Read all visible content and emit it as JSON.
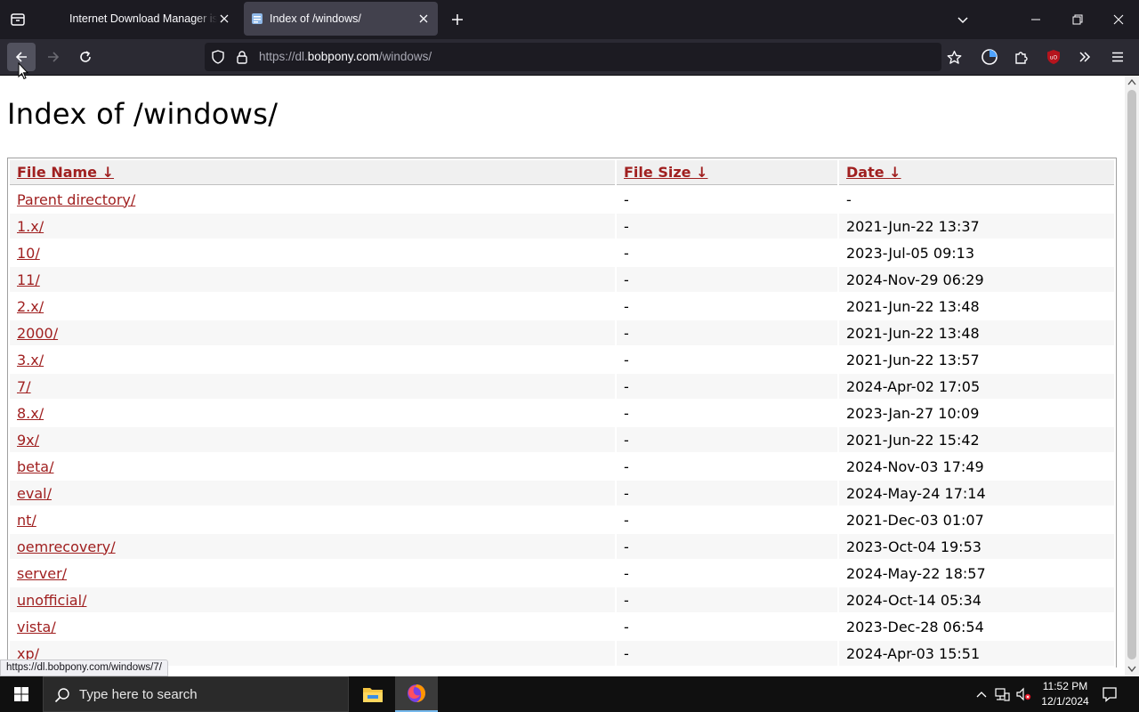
{
  "browser": {
    "tabs": [
      {
        "title": "Internet Download Manager is c"
      },
      {
        "title": "Index of /windows/"
      }
    ],
    "url": {
      "host_prefix": "https://dl.",
      "host_main": "bobpony.com",
      "path": "/windows/"
    }
  },
  "page": {
    "title": "Index of /windows/",
    "columns": {
      "name": "File Name  ↓",
      "size": "File Size  ↓",
      "date": "Date  ↓"
    },
    "rows": [
      {
        "name": "Parent directory/",
        "size": "-",
        "date": "-"
      },
      {
        "name": "1.x/",
        "size": "-",
        "date": "2021-Jun-22 13:37"
      },
      {
        "name": "10/",
        "size": "-",
        "date": "2023-Jul-05 09:13"
      },
      {
        "name": "11/",
        "size": "-",
        "date": "2024-Nov-29 06:29"
      },
      {
        "name": "2.x/",
        "size": "-",
        "date": "2021-Jun-22 13:48"
      },
      {
        "name": "2000/",
        "size": "-",
        "date": "2021-Jun-22 13:48"
      },
      {
        "name": "3.x/",
        "size": "-",
        "date": "2021-Jun-22 13:57"
      },
      {
        "name": "7/",
        "size": "-",
        "date": "2024-Apr-02 17:05"
      },
      {
        "name": "8.x/",
        "size": "-",
        "date": "2023-Jan-27 10:09"
      },
      {
        "name": "9x/",
        "size": "-",
        "date": "2021-Jun-22 15:42"
      },
      {
        "name": "beta/",
        "size": "-",
        "date": "2024-Nov-03 17:49"
      },
      {
        "name": "eval/",
        "size": "-",
        "date": "2024-May-24 17:14"
      },
      {
        "name": "nt/",
        "size": "-",
        "date": "2021-Dec-03 01:07"
      },
      {
        "name": "oemrecovery/",
        "size": "-",
        "date": "2023-Oct-04 19:53"
      },
      {
        "name": "server/",
        "size": "-",
        "date": "2024-May-22 18:57"
      },
      {
        "name": "unofficial/",
        "size": "-",
        "date": "2024-Oct-14 05:34"
      },
      {
        "name": "vista/",
        "size": "-",
        "date": "2023-Dec-28 06:54"
      },
      {
        "name": "xp/",
        "size": "-",
        "date": "2024-Apr-03 15:51"
      }
    ]
  },
  "status_url": "https://dl.bobpony.com/windows/7/",
  "taskbar": {
    "search_placeholder": "Type here to search",
    "time": "11:52 PM",
    "date": "12/1/2024"
  },
  "colors": {
    "link": "#a02020",
    "tab_active": "#42414d",
    "chrome_bg": "#1c1b22"
  }
}
